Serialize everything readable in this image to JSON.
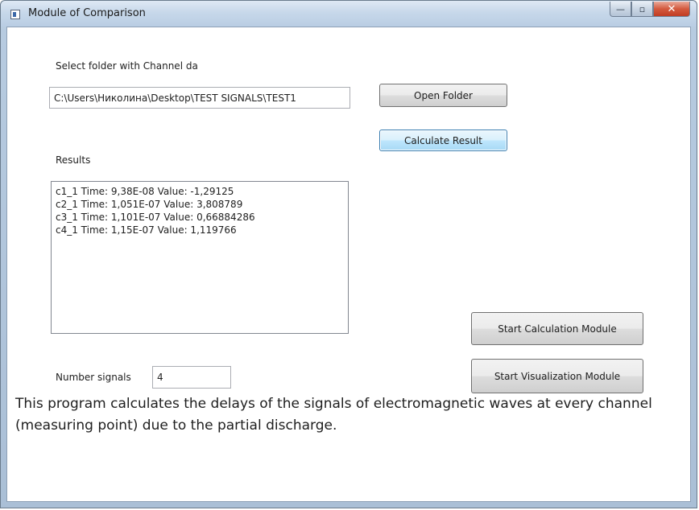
{
  "window": {
    "title": "Module of Comparison",
    "minimize_glyph": "—",
    "maximize_glyph": "▫",
    "close_glyph": "✕"
  },
  "folder": {
    "label": "Select folder with Channel da",
    "path_value": "C:\\Users\\Николина\\Desktop\\TEST SIGNALS\\TEST1",
    "open_button": "Open Folder"
  },
  "calculate_button": "Calculate Result",
  "results": {
    "label": "Results",
    "lines": [
      "c1_1  Time: 9,38E-08  Value: -1,29125",
      "c2_1  Time: 1,051E-07  Value: 3,808789",
      "c3_1  Time: 1,101E-07  Value: 0,66884286",
      "c4_1  Time: 1,15E-07  Value: 1,119766"
    ]
  },
  "signals": {
    "label": "Number signals",
    "value": "4"
  },
  "modules": {
    "calculation_button": "Start Calculation Module",
    "visualization_button": "Start Visualization Module"
  },
  "description": "This program calculates the delays of the signals of electromagnetic waves at every channel (measuring point) due to the partial discharge."
}
